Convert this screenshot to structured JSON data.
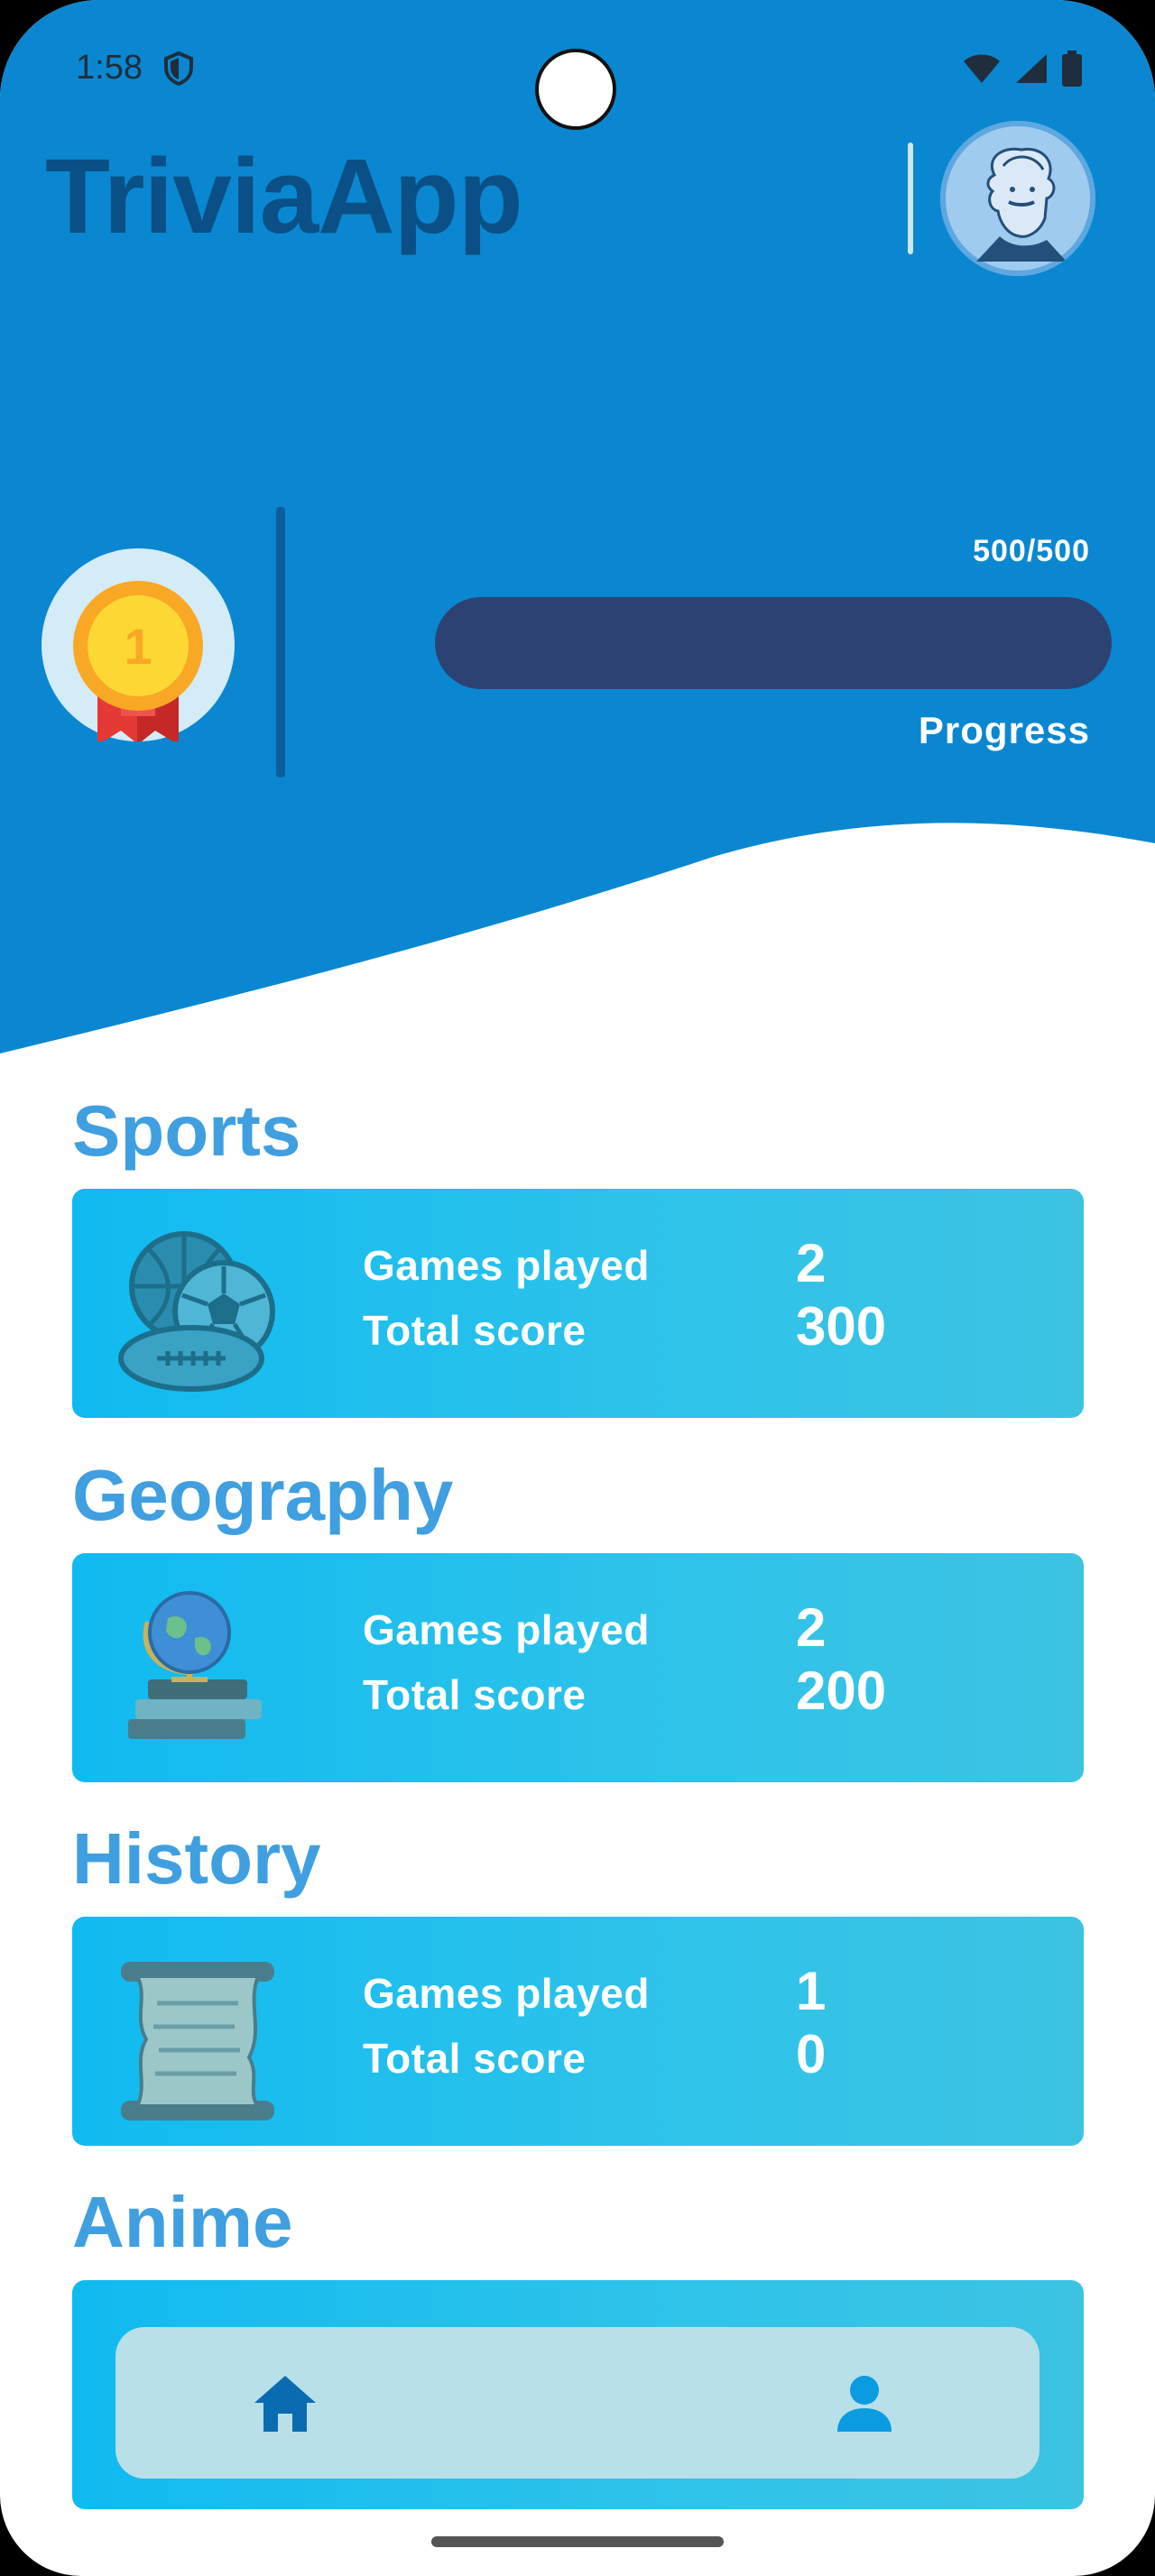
{
  "status_bar": {
    "time": "1:58",
    "icons": [
      "shield-icon",
      "wifi-icon",
      "signal-icon",
      "battery-icon"
    ]
  },
  "app": {
    "title": "TriviaApp",
    "avatar_icon": "einstein-avatar-icon"
  },
  "progress": {
    "value_text": "500/500",
    "label": "Progress",
    "fraction": 1.0,
    "badge_icon": "gold-medal-icon"
  },
  "categories": [
    {
      "title": "Sports",
      "icon": "sports-balls-icon",
      "games_label": "Games played",
      "games_value": "2",
      "score_label": "Total score",
      "score_value": "300"
    },
    {
      "title": "Geography",
      "icon": "globe-icon",
      "games_label": "Games played",
      "games_value": "2",
      "score_label": "Total score",
      "score_value": "200"
    },
    {
      "title": "History",
      "icon": "scroll-icon",
      "games_label": "Games played",
      "games_value": "1",
      "score_label": "Total score",
      "score_value": "0"
    },
    {
      "title": "Anime",
      "icon": "",
      "games_label": "",
      "games_value": "",
      "score_label": "",
      "score_value": ""
    }
  ],
  "bottom_nav": {
    "items": [
      {
        "icon": "home-icon"
      },
      {
        "icon": "profile-icon"
      }
    ]
  },
  "colors": {
    "header_blue": "#0a87d0",
    "title_dark": "#0a4f85",
    "category_title": "#3f9fe0",
    "card_gradient_start": "#10baf0",
    "progress_fill": "#2b4273",
    "nav_bg": "#b9dfe9",
    "nav_icon": "#0a6bb0"
  }
}
